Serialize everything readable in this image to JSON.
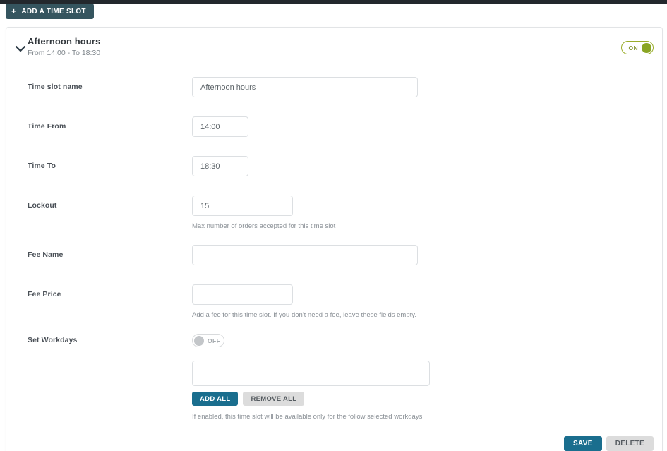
{
  "top_bar": {
    "present": true,
    "color": "#23282d"
  },
  "toolbar": {
    "add_slot_label": "ADD A TIME SLOT",
    "add_icon": "plus-icon"
  },
  "slot_card": {
    "collapse_icon": "chevron-down-icon",
    "title": "Afternoon hours",
    "subtitle": "From 14:00 - To 18:30",
    "enabled_toggle": {
      "state": "on",
      "label": "ON",
      "color": "#8aa524"
    },
    "fields": [
      {
        "label": "Time slot name",
        "name": "time-slot-name",
        "value": "Afternoon hours",
        "placeholder": "",
        "hint": ""
      },
      {
        "label": "Time From",
        "name": "time-from",
        "value": "14:00",
        "placeholder": "",
        "hint": ""
      },
      {
        "label": "Time To",
        "name": "time-to",
        "value": "18:30",
        "placeholder": "",
        "hint": ""
      },
      {
        "label": "Lockout",
        "name": "lockout",
        "value": "15",
        "placeholder": "",
        "hint": "Max number of orders accepted for this time slot"
      },
      {
        "label": "Fee Name",
        "name": "fee-name",
        "value": "",
        "placeholder": "",
        "hint": ""
      },
      {
        "label": "Fee Price",
        "name": "fee-price",
        "value": "",
        "placeholder": "",
        "hint": "Add a fee for this time slot. If you don't need a fee, leave these fields empty."
      }
    ],
    "workdays": {
      "label": "Set Workdays",
      "toggle": {
        "state": "off",
        "label": "OFF",
        "color": "#c3c6c9"
      },
      "input_value": "",
      "input_placeholder": "",
      "add_all_label": "ADD ALL",
      "remove_all_label": "REMOVE ALL",
      "hint": "If enabled, this time slot will be available only for the follow selected workdays"
    },
    "footer": {
      "save_label": "SAVE",
      "delete_label": "DELETE"
    }
  },
  "colors": {
    "dark_bar": "#23282d",
    "add_button": "#35555f",
    "primary": "#1a6e8e",
    "secondary": "#dcdcdc",
    "toggle_on": "#8aa524",
    "toggle_off": "#c3c6c9"
  }
}
